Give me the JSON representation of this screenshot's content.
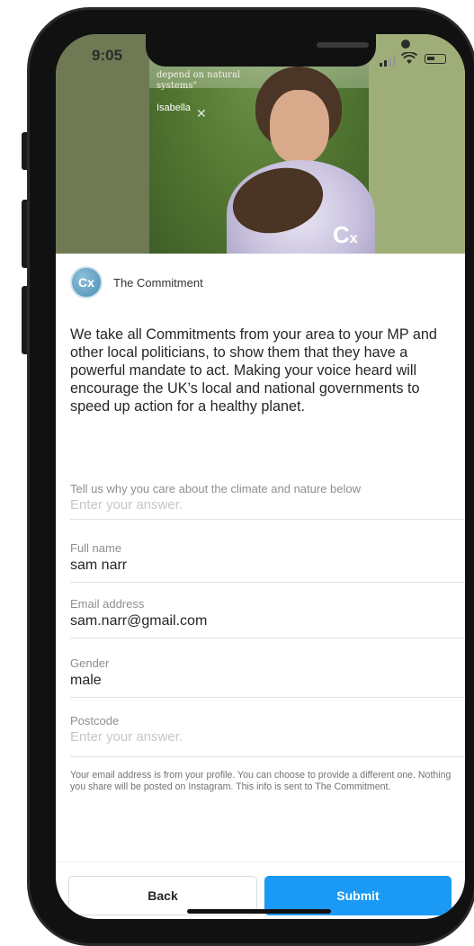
{
  "status_bar": {
    "time": "9:05"
  },
  "hero": {
    "quote_lines": [
      "depend on natural",
      "systems\""
    ],
    "author": "Isabella",
    "brand_mark": "C",
    "brand_mark_sub": "x"
  },
  "brand": {
    "logo_text": "Cx",
    "name": "The Commitment"
  },
  "intro_text": "We take all Commitments from your area to your MP and other local politicians, to show them that they have a powerful mandate to act. Making your voice heard will encourage the UK’s local and national governments to speed up action for a healthy planet.",
  "form": {
    "why_care": {
      "label": "Tell us why you care about the climate and nature below",
      "placeholder": "Enter your answer."
    },
    "full_name": {
      "label": "Full name",
      "value": "sam narr"
    },
    "email": {
      "label": "Email address",
      "value": "sam.narr@gmail.com"
    },
    "gender": {
      "label": "Gender",
      "value": "male"
    },
    "postcode": {
      "label": "Postcode",
      "placeholder": "Enter your answer."
    }
  },
  "disclaimer": "Your email address is from your profile. You can choose to provide a different one. Nothing you share will be posted on Instagram. This info is sent to The Commitment.",
  "buttons": {
    "back": "Back",
    "submit": "Submit"
  },
  "colors": {
    "submit_bg": "#1a9af5",
    "text": "#262626",
    "muted": "#8e8e8e"
  }
}
